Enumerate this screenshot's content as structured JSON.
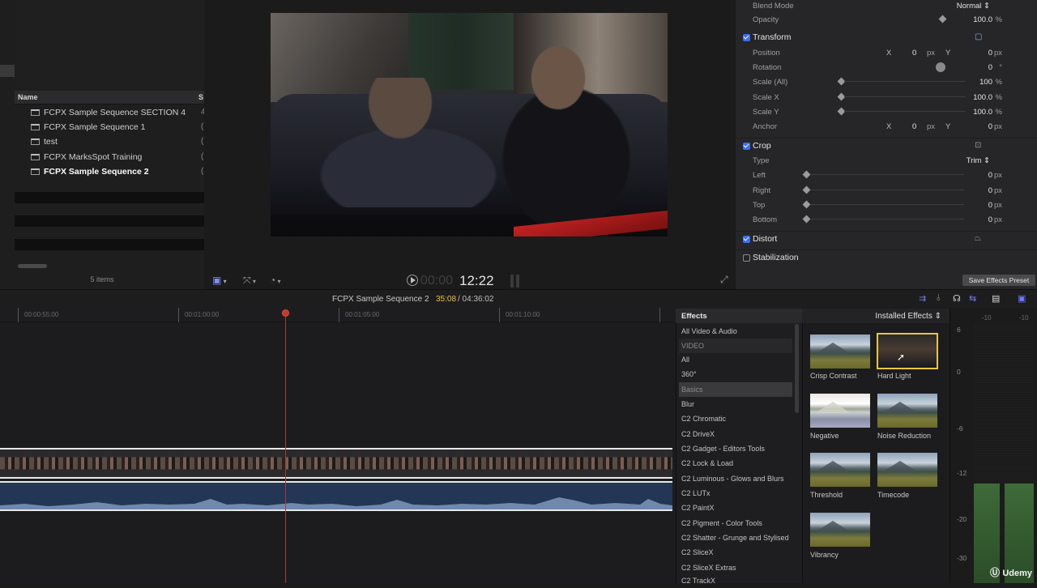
{
  "browser": {
    "col_name": "Name",
    "col_s": "S",
    "items": [
      {
        "label": "FCPX Sample Sequence SECTION 4",
        "trail": "4"
      },
      {
        "label": "FCPX Sample Sequence 1",
        "trail": "("
      },
      {
        "label": "test",
        "trail": "("
      },
      {
        "label": "FCPX MarksSpot Training",
        "trail": "("
      },
      {
        "label": "FCPX Sample Sequence 2",
        "trail": "("
      }
    ],
    "count": "5 items"
  },
  "viewer": {
    "timecode_dim": "00:00",
    "timecode": "12:22"
  },
  "inspector": {
    "blend_mode": {
      "label": "Blend Mode",
      "value": "Normal ⇕"
    },
    "opacity": {
      "label": "Opacity",
      "value": "100.0",
      "unit": "%"
    },
    "transform": {
      "title": "Transform",
      "position": {
        "label": "Position",
        "x_label": "X",
        "x": "0",
        "x_unit": "px",
        "y_label": "Y",
        "y": "0",
        "y_unit": "px"
      },
      "rotation": {
        "label": "Rotation",
        "value": "0",
        "unit": "°"
      },
      "scale_all": {
        "label": "Scale (All)",
        "value": "100",
        "unit": "%"
      },
      "scale_x": {
        "label": "Scale X",
        "value": "100.0",
        "unit": "%"
      },
      "scale_y": {
        "label": "Scale Y",
        "value": "100.0",
        "unit": "%"
      },
      "anchor": {
        "label": "Anchor",
        "x_label": "X",
        "x": "0",
        "x_unit": "px",
        "y_label": "Y",
        "y": "0",
        "y_unit": "px"
      }
    },
    "crop": {
      "title": "Crop",
      "type": {
        "label": "Type",
        "value": "Trim ⇕"
      },
      "left": {
        "label": "Left",
        "value": "0",
        "unit": "px"
      },
      "right": {
        "label": "Right",
        "value": "0",
        "unit": "px"
      },
      "top": {
        "label": "Top",
        "value": "0",
        "unit": "px"
      },
      "bottom": {
        "label": "Bottom",
        "value": "0",
        "unit": "px"
      }
    },
    "distort": {
      "title": "Distort"
    },
    "stabilization": {
      "title": "Stabilization"
    },
    "save_preset": "Save Effects Preset"
  },
  "timeline": {
    "sequence_name": "FCPX Sample Sequence 2",
    "position": "35:08",
    "duration": "/ 04:36:02",
    "ruler": [
      "00:00:55:00",
      "00:01:00:00",
      "00:01:05:00",
      "00:01:10:00"
    ]
  },
  "effects": {
    "title": "Effects",
    "installed": "Installed Effects ⇕",
    "categories": [
      "All Video & Audio",
      "VIDEO",
      "All",
      "360°",
      "Basics",
      "Blur",
      "C2 Chromatic",
      "C2 DriveX",
      "C2 Gadget - Editors Tools",
      "C2 Lock & Load",
      "C2 Luminous - Glows and Blurs",
      "C2 LUTx",
      "C2 PaintX",
      "C2 Pigment - Color Tools",
      "C2 Shatter - Grunge and Stylised",
      "C2 SliceX",
      "C2 SliceX Extras",
      "C2 TrackX"
    ],
    "thumbs": [
      "Crisp Contrast",
      "Hard Light",
      "Negative",
      "Noise Reduction",
      "Threshold",
      "Timecode",
      "Vibrancy"
    ]
  },
  "meters": {
    "top": [
      "-10",
      "-10"
    ],
    "scale": [
      "6",
      "0",
      "-6",
      "-12",
      "-20",
      "-30"
    ]
  },
  "watermark": "Udemy"
}
